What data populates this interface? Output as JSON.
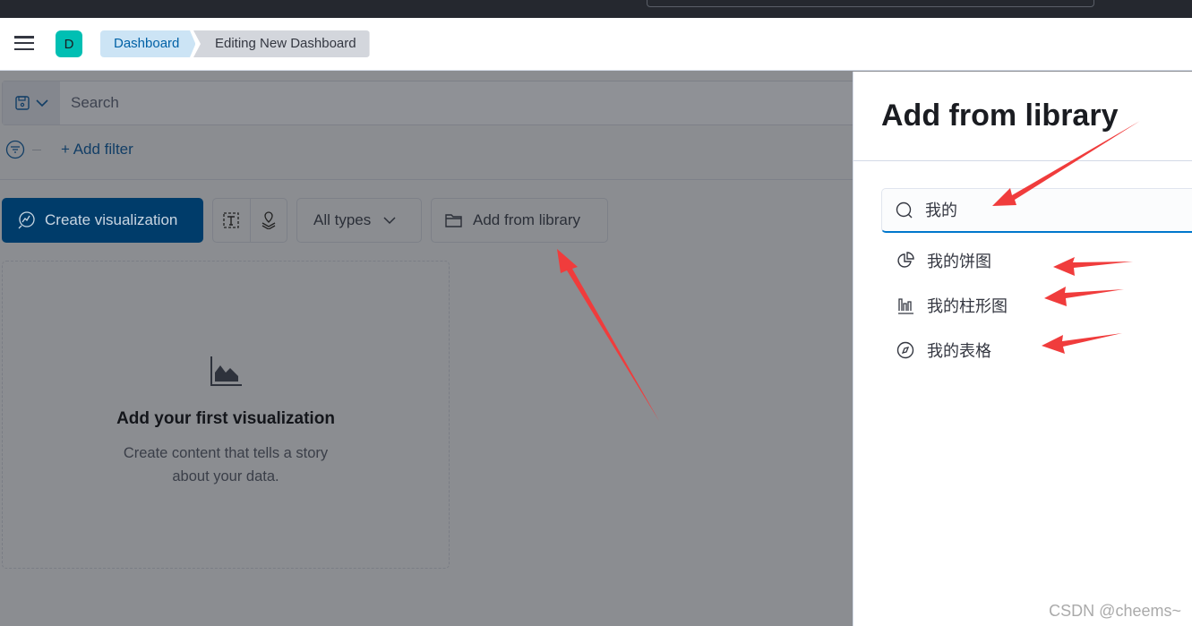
{
  "header": {
    "avatar_letter": "D",
    "breadcrumbs": [
      "Dashboard",
      "Editing New Dashboard"
    ]
  },
  "query": {
    "search_placeholder": "Search",
    "add_filter": "+ Add filter"
  },
  "toolbar": {
    "create_visualization": "Create visualization",
    "all_types": "All types",
    "add_from_library": "Add from library"
  },
  "empty_state": {
    "title": "Add your first visualization",
    "description_line1": "Create content that tells a story",
    "description_line2": "about your data."
  },
  "flyout": {
    "title": "Add from library",
    "search_value": "我的",
    "items": [
      {
        "label": "我的饼图",
        "icon": "pie-chart-icon"
      },
      {
        "label": "我的柱形图",
        "icon": "bar-chart-icon"
      },
      {
        "label": "我的表格",
        "icon": "compass-icon"
      }
    ]
  },
  "annotation_color": "#f03c3c",
  "watermark": "CSDN @cheems~"
}
